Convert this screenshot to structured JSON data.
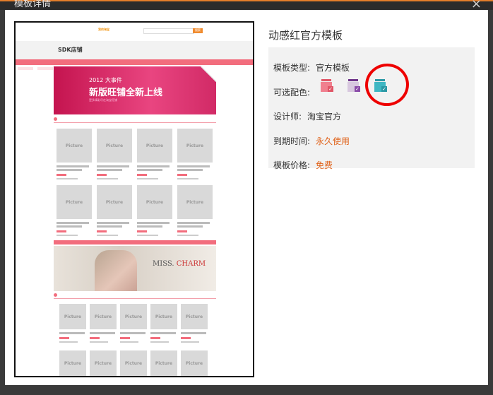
{
  "window": {
    "title": "模板详情",
    "close_label": "×"
  },
  "template": {
    "name": "动感红官方模板",
    "fields": [
      {
        "label": "模板类型:",
        "value": "官方模板",
        "accent": false
      },
      {
        "label": "可选配色:",
        "value": "",
        "accent": false
      },
      {
        "label": "设计师:",
        "value": "淘宝官方",
        "accent": false
      },
      {
        "label": "到期时间:",
        "value": "永久使用",
        "accent": true
      },
      {
        "label": "模板价格:",
        "value": "免费",
        "accent": true
      }
    ],
    "color_options": [
      {
        "name": "pink",
        "color": "#f07f8e",
        "dark": "#e05566"
      },
      {
        "name": "purple",
        "color": "#8a4ba8",
        "dark": "#6d3388"
      },
      {
        "name": "teal",
        "color": "#3fb7c3",
        "dark": "#2a98a5"
      }
    ]
  },
  "preview": {
    "logo_text": "我的淘宝",
    "search_btn": "搜索",
    "shop_name": "SDK店铺",
    "banner_year": "2012 大事件",
    "banner_title": "新版旺铺全新上线",
    "banner_sub": "更多精彩尽在淘宝旺铺",
    "placeholder": "Picture",
    "banner2_text": "MISS.",
    "banner2_accent": "CHARM"
  },
  "annotation": {
    "color": "#ee0000"
  }
}
